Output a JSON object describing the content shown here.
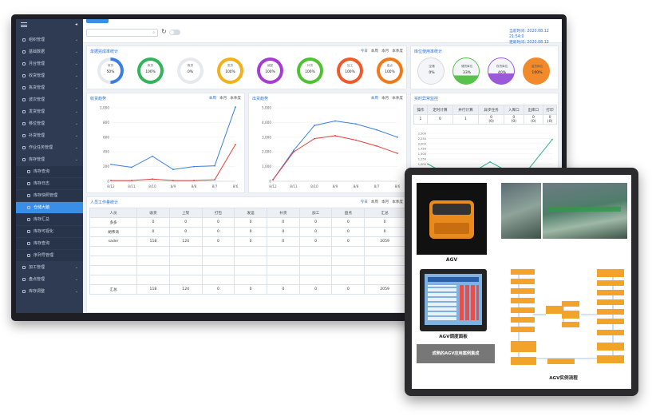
{
  "sidebar": {
    "items": [
      {
        "label": "组织管理",
        "kind": "group"
      },
      {
        "label": "基础数据",
        "kind": "group"
      },
      {
        "label": "月台管理",
        "kind": "group"
      },
      {
        "label": "收货管理",
        "kind": "group"
      },
      {
        "label": "拣货管理",
        "kind": "group"
      },
      {
        "label": "波次管理",
        "kind": "group"
      },
      {
        "label": "发货管理",
        "kind": "group"
      },
      {
        "label": "移位管理",
        "kind": "group"
      },
      {
        "label": "补货管理",
        "kind": "group"
      },
      {
        "label": "作业任务管理",
        "kind": "group"
      },
      {
        "label": "库存管理",
        "kind": "group"
      },
      {
        "label": "库存查询",
        "kind": "sub"
      },
      {
        "label": "库存日志",
        "kind": "sub"
      },
      {
        "label": "库存快照管理",
        "kind": "sub"
      },
      {
        "label": "仓储大脑",
        "kind": "sub-active"
      },
      {
        "label": "库存汇总",
        "kind": "sub"
      },
      {
        "label": "库存可视化",
        "kind": "sub"
      },
      {
        "label": "库存查询",
        "kind": "sub"
      },
      {
        "label": "序列号管理",
        "kind": "sub"
      },
      {
        "label": "加工管理",
        "kind": "group"
      },
      {
        "label": "盘点管理",
        "kind": "group"
      },
      {
        "label": "库存调整",
        "kind": "group"
      }
    ]
  },
  "header": {
    "current_time_label": "当前时间:",
    "current_time": "2020.08.12 21:54:0",
    "update_time_label": "更新时间:",
    "update_time": "2020.08.12 20:03:4"
  },
  "tabs": {
    "today": "今日",
    "week": "本周",
    "month": "本月",
    "quarter": "本季度"
  },
  "completion_card": {
    "title": "单据完成率统计",
    "rings": [
      {
        "label": "收货",
        "value": "50%",
        "pct": 50,
        "color": "#3a7fe0"
      },
      {
        "label": "拣货",
        "value": "100%",
        "pct": 100,
        "color": "#33b35a"
      },
      {
        "label": "拣货",
        "value": "0%",
        "pct": 0,
        "color": "#bbbbbb"
      },
      {
        "label": "发货",
        "value": "100%",
        "pct": 100,
        "color": "#f2b11c"
      },
      {
        "label": "装配",
        "value": "100%",
        "pct": 100,
        "color": "#a63dd0"
      },
      {
        "label": "补货",
        "value": "100%",
        "pct": 100,
        "color": "#4fc233"
      },
      {
        "label": "加工",
        "value": "100%",
        "pct": 100,
        "color": "#ee5a2a"
      },
      {
        "label": "盘点",
        "value": "100%",
        "pct": 100,
        "color": "#f07a1a"
      }
    ]
  },
  "location_card": {
    "title": "库位使用率统计",
    "balls": [
      {
        "label": "空储",
        "value": "0%",
        "fill": 0,
        "color": "#cccccc"
      },
      {
        "label": "储货库位",
        "value": "33%",
        "fill": 0.33,
        "color": "#59c24a"
      },
      {
        "label": "存货库位",
        "value": "40%",
        "fill": 0.4,
        "color": "#9a59d9"
      },
      {
        "label": "溢货库位",
        "value": "100%",
        "fill": 1.0,
        "color": "#f08a2a"
      }
    ]
  },
  "receive_trend": {
    "title": "收货趋势",
    "chart_data": {
      "type": "line",
      "categories": [
        "8/12",
        "8/11",
        "8/10",
        "8/9",
        "8/8",
        "8/7",
        "8/6"
      ],
      "ylim": [
        0,
        1000
      ],
      "yticks": [
        0,
        200,
        400,
        600,
        800,
        1000
      ],
      "series": [
        {
          "values": [
            230,
            190,
            340,
            160,
            200,
            210,
            1010
          ],
          "color": "#3a7fe0"
        },
        {
          "values": [
            10,
            10,
            30,
            10,
            10,
            20,
            500
          ],
          "color": "#e0403a"
        }
      ]
    }
  },
  "ship_trend": {
    "title": "出货趋势",
    "chart_data": {
      "type": "line",
      "categories": [
        "8/12",
        "8/11",
        "8/10",
        "8/9",
        "8/8",
        "8/7",
        "8/6"
      ],
      "ylim": [
        0,
        5000
      ],
      "yticks": [
        0,
        1000,
        2000,
        3000,
        4000,
        5000
      ],
      "series": [
        {
          "values": [
            100,
            2100,
            3800,
            4100,
            3900,
            3500,
            3000
          ],
          "color": "#3a7fe0"
        },
        {
          "values": [
            100,
            2000,
            2900,
            3100,
            2800,
            2400,
            1900
          ],
          "color": "#e0403a"
        }
      ]
    }
  },
  "monitor_card": {
    "title": "实时异常监控",
    "headers": [
      "操作",
      "定时计算",
      "并行计算",
      "异步任务",
      "入库口",
      "出库口",
      "打印"
    ],
    "row": [
      "1",
      "0",
      "1",
      "0\n(0)",
      "0\n(0)",
      "0\n(0)",
      "0\n(0)"
    ],
    "chart_data": {
      "type": "line",
      "ylim": [
        0,
        2500
      ],
      "yticks": [
        0,
        250,
        500,
        750,
        1000,
        1250,
        1500,
        1750,
        2000,
        2250,
        2500
      ],
      "series": [
        {
          "values": [
            1000,
            200,
            1100,
            300,
            2200
          ],
          "color": "#2fb38a"
        }
      ]
    }
  },
  "staff_card": {
    "title": "人员工作量统计",
    "headers": [
      "人员",
      "收货",
      "上架",
      "打包",
      "发运",
      "补货",
      "加工",
      "盘点",
      "汇总"
    ],
    "rows": [
      [
        "多多",
        "0",
        "0",
        "0",
        "0",
        "0",
        "0",
        "0",
        "0"
      ],
      [
        "胡伟涛",
        "0",
        "0",
        "0",
        "0",
        "0",
        "0",
        "0",
        "0"
      ],
      [
        "sader",
        "118",
        "124",
        "0",
        "0",
        "0",
        "0",
        "0",
        "2059"
      ]
    ],
    "total": [
      "汇总",
      "118",
      "124",
      "0",
      "0",
      "0",
      "0",
      "0",
      "2059"
    ]
  },
  "agv": {
    "product_caption": "AGV",
    "panel_caption": "AGV调度面板",
    "banner": "成熟的AGV应用案例集成",
    "flow_caption": "AGV实例流程"
  }
}
